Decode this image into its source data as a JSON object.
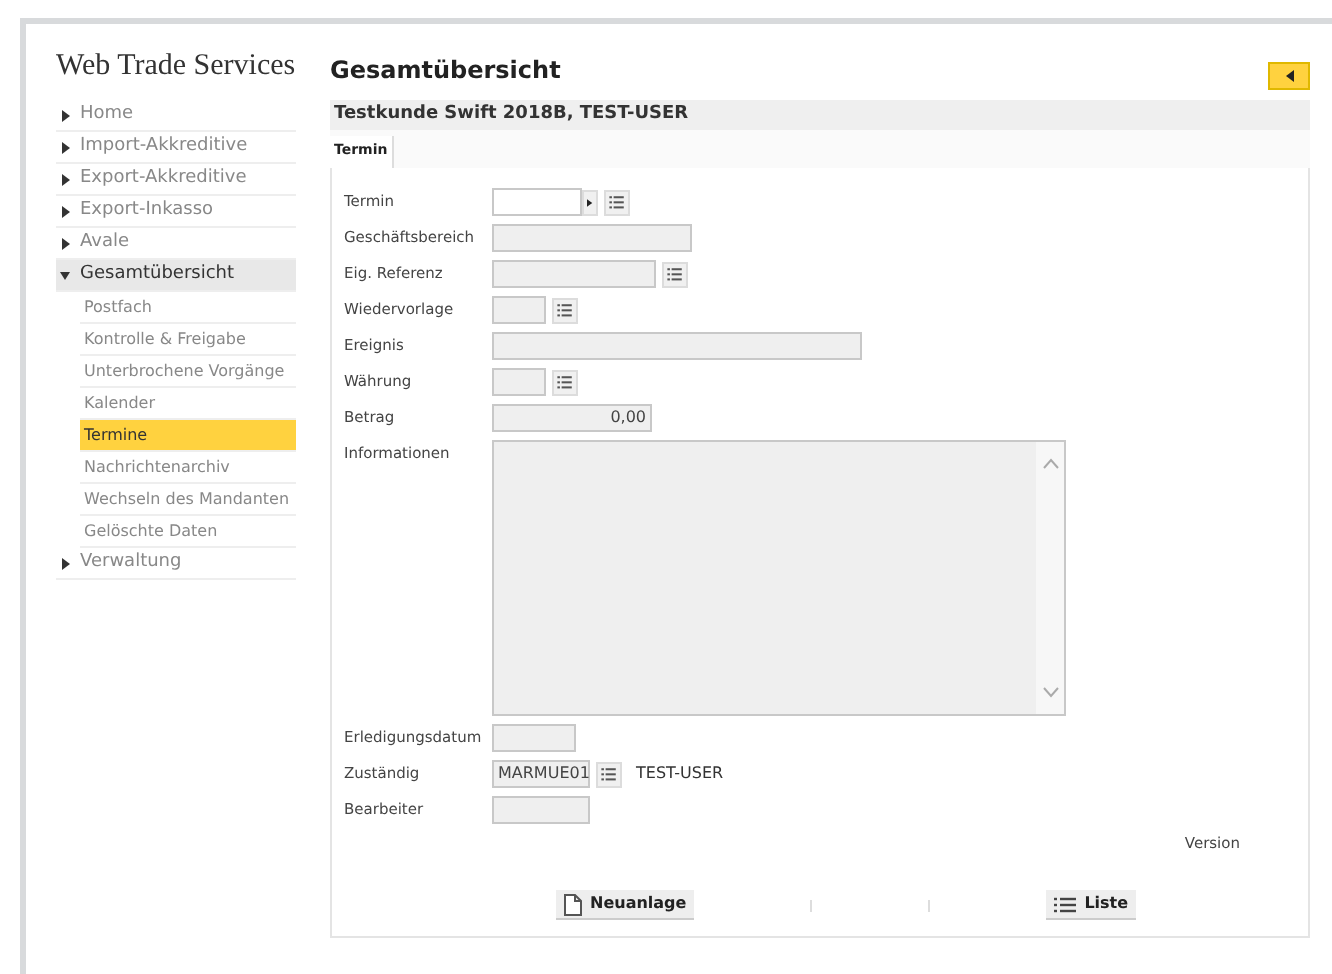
{
  "brand": "Web Trade Services",
  "page_title": "Gesamtübersicht",
  "customer": "Testkunde Swift 2018B, TEST-USER",
  "nav": [
    {
      "label": "Home",
      "expanded": false
    },
    {
      "label": "Import-Akkreditive",
      "expanded": false
    },
    {
      "label": "Export-Akkreditive",
      "expanded": false
    },
    {
      "label": "Export-Inkasso",
      "expanded": false
    },
    {
      "label": "Avale",
      "expanded": false
    },
    {
      "label": "Gesamtübersicht",
      "expanded": true,
      "children": [
        {
          "label": "Postfach",
          "selected": false
        },
        {
          "label": "Kontrolle & Freigabe",
          "selected": false
        },
        {
          "label": "Unterbrochene Vorgänge",
          "selected": false
        },
        {
          "label": "Kalender",
          "selected": false
        },
        {
          "label": "Termine",
          "selected": true
        },
        {
          "label": "Nachrichtenarchiv",
          "selected": false
        },
        {
          "label": "Wechseln des Mandanten",
          "selected": false
        },
        {
          "label": "Gelöschte Daten",
          "selected": false
        }
      ]
    },
    {
      "label": "Verwaltung",
      "expanded": false
    }
  ],
  "tabs": [
    {
      "label": "Termin",
      "selected": true
    }
  ],
  "fields": [
    {
      "label": "Termin",
      "kind": "date"
    },
    {
      "label": "Geschäftsbereich",
      "kind": "text"
    },
    {
      "label": "Eig. Referenz",
      "kind": "lookup"
    },
    {
      "label": "Wiedervorlage",
      "kind": "lookup"
    },
    {
      "label": "Ereignis",
      "kind": "text"
    },
    {
      "label": "Währung",
      "kind": "lookup"
    },
    {
      "label": "Betrag",
      "kind": "amount",
      "value": "0,00"
    },
    {
      "label": "Informationen",
      "kind": "textarea"
    },
    {
      "label": "Erledigungsdatum",
      "kind": "text"
    },
    {
      "label": "Zuständig",
      "kind": "lookup",
      "value": "MARMUE01",
      "note": "TEST-USER"
    },
    {
      "label": "Bearbeiter",
      "kind": "text"
    }
  ],
  "version_label": "Version",
  "buttons": [
    {
      "label": "Neuanlage",
      "kind": "new"
    },
    {
      "label": "Liste",
      "kind": "list"
    }
  ]
}
